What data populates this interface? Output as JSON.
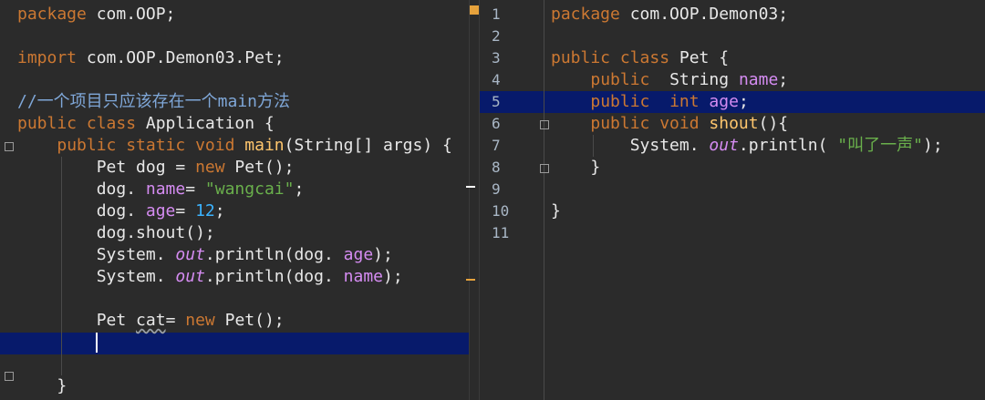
{
  "left_editor": {
    "lines": [
      {
        "segs": [
          [
            "kw",
            "package"
          ],
          [
            "",
            "com.OOP;"
          ]
        ]
      },
      {
        "segs": []
      },
      {
        "segs": [
          [
            "kw",
            "import"
          ],
          [
            "",
            "com.OOP.Demon03.Pet;"
          ]
        ]
      },
      {
        "segs": []
      },
      {
        "segs": [
          [
            "cm",
            "//一个项目只应该存在一个main方法"
          ]
        ]
      },
      {
        "segs": [
          [
            "kw",
            "public class"
          ],
          [
            "",
            "Application {"
          ]
        ]
      },
      {
        "segs": [
          [
            "",
            "    "
          ],
          [
            "kw",
            "public static void"
          ],
          [
            "fn",
            "main"
          ],
          [
            "",
            "(String[] args) {"
          ]
        ]
      },
      {
        "segs": [
          [
            "",
            "        Pet dog = "
          ],
          [
            "kw",
            "new"
          ],
          [
            "",
            "Pet();"
          ]
        ]
      },
      {
        "segs": [
          [
            "",
            "        dog."
          ],
          [
            "fld",
            "name"
          ],
          [
            "",
            "= "
          ],
          [
            "str",
            "\"wangcai\""
          ],
          [
            "",
            "; "
          ]
        ]
      },
      {
        "segs": [
          [
            "",
            "        dog."
          ],
          [
            "fld",
            "age"
          ],
          [
            "",
            "= "
          ],
          [
            "num",
            "12"
          ],
          [
            "",
            ";"
          ]
        ]
      },
      {
        "segs": [
          [
            "",
            "        dog.shout();"
          ]
        ]
      },
      {
        "segs": [
          [
            "",
            "        System."
          ],
          [
            "it",
            "out"
          ],
          [
            "",
            ".println(dog."
          ],
          [
            "fld",
            "age"
          ],
          [
            "",
            ");"
          ]
        ]
      },
      {
        "segs": [
          [
            "",
            "        System."
          ],
          [
            "it",
            "out"
          ],
          [
            "",
            ".println(dog."
          ],
          [
            "fld",
            "name"
          ],
          [
            "",
            ");"
          ]
        ]
      },
      {
        "segs": []
      },
      {
        "segs": [
          [
            "",
            "        Pet "
          ],
          [
            "wv",
            "cat"
          ],
          [
            "",
            "= "
          ],
          [
            "kw",
            "new"
          ],
          [
            "",
            "Pet();"
          ]
        ]
      },
      {
        "segs": []
      },
      {
        "segs": []
      },
      {
        "segs": [
          [
            "",
            "    }"
          ]
        ]
      }
    ]
  },
  "right_editor": {
    "line_numbers": [
      "1",
      "2",
      "3",
      "4",
      "5",
      "6",
      "7",
      "8",
      "9",
      "10",
      "11"
    ],
    "lines": [
      {
        "segs": [
          [
            "kw",
            "package"
          ],
          [
            "",
            "com.OOP.Demon03;"
          ]
        ]
      },
      {
        "segs": []
      },
      {
        "segs": [
          [
            "kw",
            "public class"
          ],
          [
            "",
            "Pet {"
          ]
        ]
      },
      {
        "segs": [
          [
            "",
            "    "
          ],
          [
            "kw",
            "public"
          ],
          [
            "",
            "  String "
          ],
          [
            "fld",
            "name"
          ],
          [
            "",
            ";"
          ]
        ]
      },
      {
        "segs": [
          [
            "",
            "    "
          ],
          [
            "kw",
            "public"
          ],
          [
            "",
            "  "
          ],
          [
            "kw",
            "int"
          ],
          [
            "",
            ""
          ],
          [
            "fld",
            "age"
          ],
          [
            "",
            ";"
          ]
        ]
      },
      {
        "segs": [
          [
            "",
            "    "
          ],
          [
            "kw",
            "public void"
          ],
          [
            "fn",
            "shout"
          ],
          [
            "",
            "(){"
          ]
        ]
      },
      {
        "segs": [
          [
            "",
            "        System."
          ],
          [
            "it",
            "out"
          ],
          [
            "",
            ".println("
          ],
          [
            "str",
            "\"叫了一声\""
          ],
          [
            "",
            ");"
          ]
        ]
      },
      {
        "segs": [
          [
            "",
            "    }"
          ]
        ]
      },
      {
        "segs": []
      },
      {
        "segs": [
          [
            "",
            "}"
          ]
        ]
      },
      {
        "segs": []
      }
    ]
  },
  "colors": {
    "background": "#2b2b2b",
    "current_line": "#071a6b",
    "keyword": "#cc7832",
    "method": "#ffc66d",
    "field": "#d58cf2",
    "string": "#6ab04c",
    "number": "#3bb3ff",
    "comment": "#7fa7d8"
  }
}
